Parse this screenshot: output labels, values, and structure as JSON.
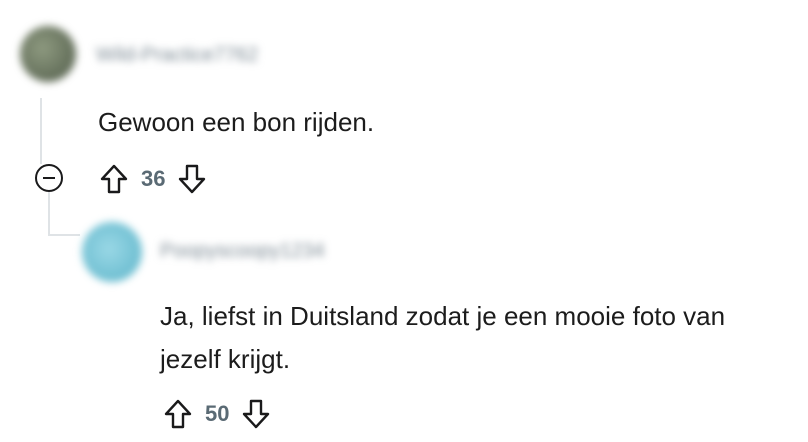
{
  "comments": [
    {
      "username": "Wild-Practice7762",
      "body": "Gewoon een bon rijden.",
      "score": "36",
      "avatar_color": "#6d7a62"
    },
    {
      "username": "Poopyscoopy1234",
      "body": "Ja, liefst in Duitsland zodat je een mooie foto van\njezelf krijgt.",
      "score": "50",
      "avatar_color": "#7cc6d8"
    }
  ],
  "icons": {
    "upvote": "arrow-up-outline",
    "downvote": "arrow-down-outline",
    "collapse": "circle-minus"
  },
  "colors": {
    "thread_line": "#dfe3e6",
    "score_text": "#5a6a74",
    "body_text": "#1c1c1c"
  }
}
